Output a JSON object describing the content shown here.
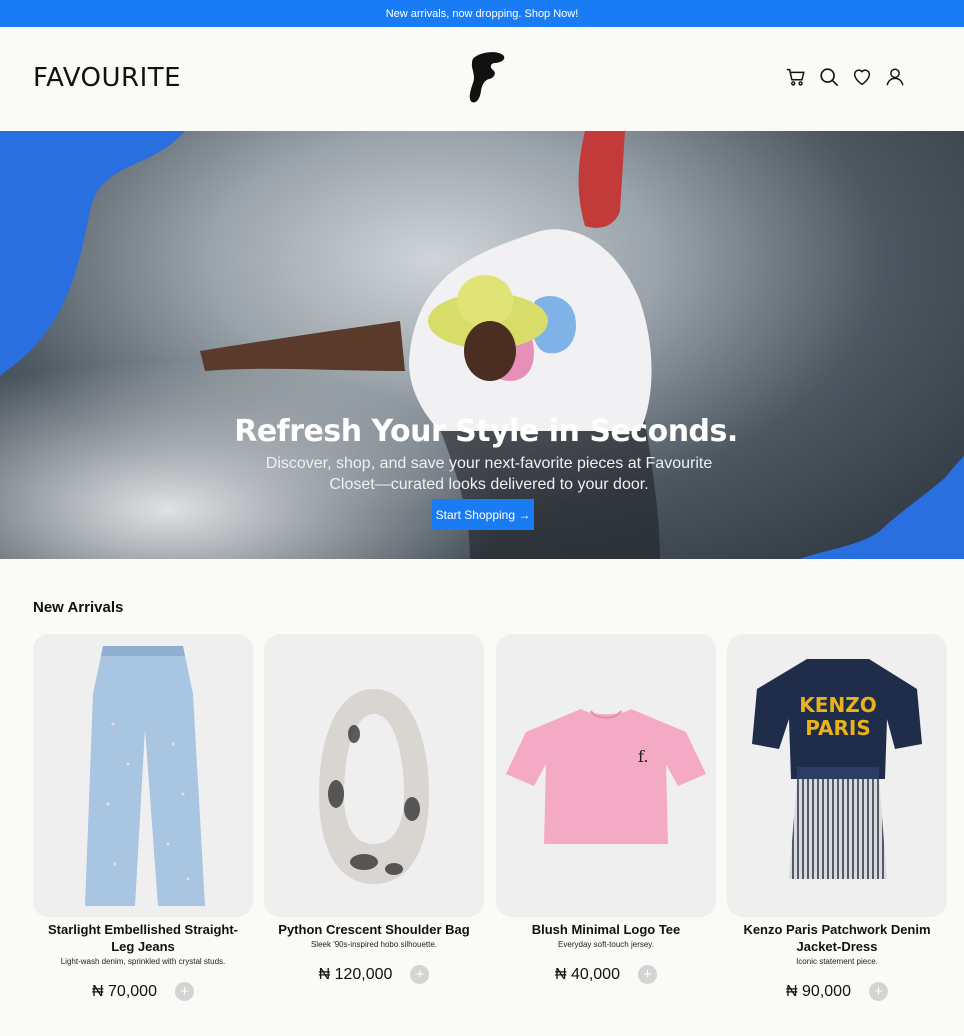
{
  "announcement": "New arrivals, now dropping. Shop Now!",
  "header": {
    "wordmark": "FAVOURITE",
    "icons": [
      "cart-icon",
      "search-icon",
      "heart-icon",
      "user-icon"
    ]
  },
  "hero": {
    "title": "Refresh Your Style in Seconds.",
    "subtitle": "Discover, shop, and save your next-favorite pieces at Favourite Closet—curated looks delivered to your door.",
    "cta": "Start Shopping →"
  },
  "section_title": "New Arrivals",
  "products": [
    {
      "name": "Starlight Embellished Straight-Leg Jeans",
      "desc": "Light-wash denim, sprinkled with crystal studs.",
      "price": "₦ 70,000"
    },
    {
      "name": "Python Crescent Shoulder Bag",
      "desc": "Sleek '90s-inspired hobo silhouette.",
      "price": "₦ 120,000"
    },
    {
      "name": "Blush Minimal Logo Tee",
      "desc": "Everyday soft-touch jersey.",
      "price": "₦ 40,000"
    },
    {
      "name": "Kenzo Paris Patchwork Denim Jacket-Dress",
      "desc": "Iconic statement piece.",
      "price": "₦ 90,000"
    }
  ],
  "colors": {
    "accent": "#1a7cf5",
    "background": "#fafaf7",
    "card": "#f0eff0"
  }
}
